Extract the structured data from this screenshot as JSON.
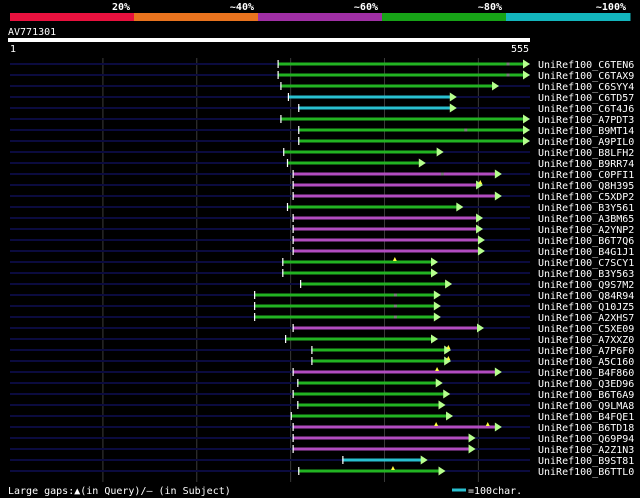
{
  "header": {
    "query_id": "AV771301",
    "range_start": "1",
    "range_end": "555",
    "query_length": 555
  },
  "legend": {
    "segments": [
      {
        "label": "20%",
        "color": "#e8113e"
      },
      {
        "label": "~40%",
        "color": "#e8731e"
      },
      {
        "label": "~60%",
        "color": "#a02fa5"
      },
      {
        "label": "~80%",
        "color": "#17a317"
      },
      {
        "label": "~100%",
        "color": "#13b5bd"
      }
    ]
  },
  "colors": {
    "background": "#000000",
    "row_line": "#0b0b3f",
    "guide_line": "#3a3a3a",
    "arrow_fill": "#b6ff8d",
    "gap_marker": "#ffff40",
    "magenta": "#b24cc0",
    "green": "#22b322",
    "cyan": "#29c0d0"
  },
  "footer": {
    "gaps_text": "Large gaps:▲(in Query)/– (in Subject)",
    "scale_text": "=100char."
  },
  "hits": [
    {
      "name": "UniRef100_C6TEN6",
      "start": 286,
      "end": 555,
      "color": "green",
      "query_gaps": [],
      "subject_gaps": [
        530
      ]
    },
    {
      "name": "UniRef100_C6TAX9",
      "start": 286,
      "end": 555,
      "color": "green",
      "query_gaps": [],
      "subject_gaps": [
        530
      ]
    },
    {
      "name": "UniRef100_C6SYY4",
      "start": 289,
      "end": 522,
      "color": "green",
      "query_gaps": [],
      "subject_gaps": []
    },
    {
      "name": "UniRef100_C6TD57",
      "start": 297,
      "end": 477,
      "color": "cyan",
      "query_gaps": [],
      "subject_gaps": []
    },
    {
      "name": "UniRef100_C6T4J6",
      "start": 308,
      "end": 477,
      "color": "cyan",
      "query_gaps": [],
      "subject_gaps": []
    },
    {
      "name": "UniRef100_A7PDT3",
      "start": 289,
      "end": 555,
      "color": "green",
      "query_gaps": [],
      "subject_gaps": []
    },
    {
      "name": "UniRef100_B9MT14",
      "start": 308,
      "end": 555,
      "color": "green",
      "query_gaps": [],
      "subject_gaps": [
        485
      ]
    },
    {
      "name": "UniRef100_A9PIL0",
      "start": 308,
      "end": 555,
      "color": "green",
      "query_gaps": [],
      "subject_gaps": []
    },
    {
      "name": "UniRef100_B8LFH2",
      "start": 292,
      "end": 463,
      "color": "green",
      "query_gaps": [],
      "subject_gaps": []
    },
    {
      "name": "UniRef100_B9RR74",
      "start": 296,
      "end": 444,
      "color": "green",
      "query_gaps": [],
      "subject_gaps": []
    },
    {
      "name": "UniRef100_C0PFI1",
      "start": 302,
      "end": 525,
      "color": "magenta",
      "query_gaps": [],
      "subject_gaps": [
        460
      ]
    },
    {
      "name": "UniRef100_Q8H395",
      "start": 302,
      "end": 505,
      "color": "magenta",
      "query_gaps": [
        502
      ],
      "subject_gaps": []
    },
    {
      "name": "UniRef100_C5XDP2",
      "start": 302,
      "end": 525,
      "color": "magenta",
      "query_gaps": [],
      "subject_gaps": []
    },
    {
      "name": "UniRef100_B3Y561",
      "start": 296,
      "end": 484,
      "color": "green",
      "query_gaps": [],
      "subject_gaps": []
    },
    {
      "name": "UniRef100_A3BM65",
      "start": 302,
      "end": 505,
      "color": "magenta",
      "query_gaps": [],
      "subject_gaps": []
    },
    {
      "name": "UniRef100_A2YNP2",
      "start": 302,
      "end": 505,
      "color": "magenta",
      "query_gaps": [],
      "subject_gaps": []
    },
    {
      "name": "UniRef100_B6T7Q6",
      "start": 302,
      "end": 507,
      "color": "magenta",
      "query_gaps": [],
      "subject_gaps": []
    },
    {
      "name": "UniRef100_B4G1J1",
      "start": 302,
      "end": 507,
      "color": "magenta",
      "query_gaps": [],
      "subject_gaps": []
    },
    {
      "name": "UniRef100_C7SCY1",
      "start": 291,
      "end": 457,
      "color": "green",
      "query_gaps": [
        411
      ],
      "subject_gaps": []
    },
    {
      "name": "UniRef100_B3Y563",
      "start": 291,
      "end": 457,
      "color": "green",
      "query_gaps": [],
      "subject_gaps": []
    },
    {
      "name": "UniRef100_Q9S7M2",
      "start": 310,
      "end": 472,
      "color": "green",
      "query_gaps": [],
      "subject_gaps": []
    },
    {
      "name": "UniRef100_Q84R94",
      "start": 261,
      "end": 460,
      "color": "green",
      "query_gaps": [],
      "subject_gaps": [
        410
      ]
    },
    {
      "name": "UniRef100_Q10JZ5",
      "start": 261,
      "end": 460,
      "color": "green",
      "query_gaps": [],
      "subject_gaps": [
        410
      ]
    },
    {
      "name": "UniRef100_A2XHS7",
      "start": 261,
      "end": 460,
      "color": "green",
      "query_gaps": [],
      "subject_gaps": [
        410
      ]
    },
    {
      "name": "UniRef100_C5XE09",
      "start": 302,
      "end": 506,
      "color": "magenta",
      "query_gaps": [],
      "subject_gaps": []
    },
    {
      "name": "UniRef100_A7XXZ0",
      "start": 294,
      "end": 457,
      "color": "green",
      "query_gaps": [],
      "subject_gaps": []
    },
    {
      "name": "UniRef100_A7P6F0",
      "start": 322,
      "end": 471,
      "color": "green",
      "query_gaps": [
        468
      ],
      "subject_gaps": []
    },
    {
      "name": "UniRef100_A5C160",
      "start": 322,
      "end": 471,
      "color": "green",
      "query_gaps": [
        468
      ],
      "subject_gaps": []
    },
    {
      "name": "UniRef100_B4F860",
      "start": 302,
      "end": 525,
      "color": "magenta",
      "query_gaps": [
        456
      ],
      "subject_gaps": []
    },
    {
      "name": "UniRef100_Q3ED96",
      "start": 307,
      "end": 462,
      "color": "green",
      "query_gaps": [],
      "subject_gaps": []
    },
    {
      "name": "UniRef100_B6T6A9",
      "start": 302,
      "end": 470,
      "color": "green",
      "query_gaps": [],
      "subject_gaps": []
    },
    {
      "name": "UniRef100_Q9LMA8",
      "start": 307,
      "end": 465,
      "color": "green",
      "query_gaps": [],
      "subject_gaps": []
    },
    {
      "name": "UniRef100_B4FQE1",
      "start": 300,
      "end": 473,
      "color": "green",
      "query_gaps": [],
      "subject_gaps": []
    },
    {
      "name": "UniRef100_B6TD18",
      "start": 302,
      "end": 525,
      "color": "magenta",
      "query_gaps": [
        455,
        510
      ],
      "subject_gaps": []
    },
    {
      "name": "UniRef100_Q69P94",
      "start": 302,
      "end": 497,
      "color": "magenta",
      "query_gaps": [],
      "subject_gaps": []
    },
    {
      "name": "UniRef100_A2Z1N3",
      "start": 302,
      "end": 497,
      "color": "magenta",
      "query_gaps": [],
      "subject_gaps": []
    },
    {
      "name": "UniRef100_B9ST81",
      "start": 355,
      "end": 446,
      "color": "cyan",
      "query_gaps": [],
      "subject_gaps": []
    },
    {
      "name": "UniRef100_B6TTL0",
      "start": 308,
      "end": 465,
      "color": "green",
      "query_gaps": [
        409
      ],
      "subject_gaps": []
    }
  ]
}
